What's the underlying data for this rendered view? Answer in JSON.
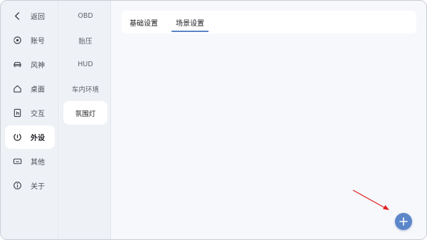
{
  "nav": {
    "items": [
      {
        "label": "返回",
        "icon": "back-arrow-icon"
      },
      {
        "label": "账号",
        "icon": "account-icon"
      },
      {
        "label": "风神",
        "icon": "car-icon"
      },
      {
        "label": "桌面",
        "icon": "home-icon"
      },
      {
        "label": "交互",
        "icon": "touch-icon"
      },
      {
        "label": "外设",
        "icon": "peripheral-icon"
      },
      {
        "label": "其他",
        "icon": "keyboard-icon"
      },
      {
        "label": "关于",
        "icon": "info-icon"
      }
    ],
    "active_index": 5
  },
  "submenu": {
    "items": [
      "OBD",
      "胎压",
      "HUD",
      "车内环境",
      "氛围灯"
    ],
    "active_index": 4
  },
  "tabs": {
    "items": [
      "基础设置",
      "场景设置"
    ],
    "active_index": 1
  },
  "fab": {
    "icon": "plus-icon"
  },
  "annotation": {
    "icon": "red-arrow",
    "color": "#e02020"
  },
  "colors": {
    "accent": "#5b86c9",
    "sidebar_bg": "#eef1f6",
    "main_bg": "#f6f8fb"
  }
}
